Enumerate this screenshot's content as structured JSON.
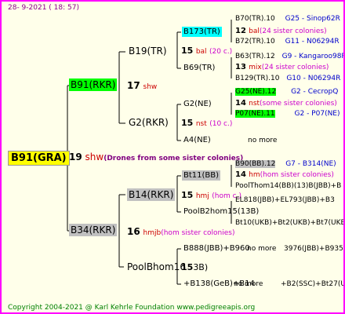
{
  "header": {
    "date": "28-  9-2021 ( 18: 57)"
  },
  "footer": {
    "copyright": "Copyright 2004-2021 @ Karl Kehrle Foundation    www.pedigreeapis.org"
  },
  "root": {
    "name": "B91(GRA)",
    "gen_num": "19",
    "gen_tag": "shw",
    "gen_note": "(Drones from some sister colonies)"
  },
  "gen1": {
    "top": {
      "name": "B91(RKR)",
      "num": "17",
      "tag": "shw"
    },
    "bottom": {
      "name": "B34(RKR)",
      "num": "16",
      "tag": "hmjb",
      "note": "(hom sister colonies)"
    }
  },
  "gen2": {
    "a": {
      "name": "B19(TR)",
      "num": "15",
      "tag": "bal",
      "note": "(20 c.)"
    },
    "b": {
      "name": "G2(RKR)",
      "num": "15",
      "tag": "nst",
      "note": "(10 c.)"
    },
    "c": {
      "name": "B14(RKR)",
      "num": "15",
      "tag": "hmj",
      "note": "(hom c.)"
    },
    "d": {
      "name": "PoolBhom16",
      "num": "15",
      "suffix": "3B)"
    }
  },
  "gen3": {
    "a1": {
      "name": "B173(TR)",
      "num": "12",
      "tag": "bal",
      "note": "(24 sister colonies)"
    },
    "a2": {
      "name": "B69(TR)",
      "num": "13",
      "tag": "mix",
      "note": "(24 sister colonies)"
    },
    "b1": {
      "name": "G2(NE)",
      "num": "14",
      "tag": "nst",
      "note": "(some sister colonies)"
    },
    "b2": {
      "name": "A4(NE)",
      "more": "no more"
    },
    "c1": {
      "name": "Bt11(BB)",
      "num": "14",
      "tag": "hm",
      "note": "(hom sister colonies)"
    },
    "c2": {
      "name": "PoolB2hom15(13B)"
    },
    "d1": {
      "name": "B888(JBB)+B960",
      "more": "no more"
    },
    "d2": {
      "name": "+B138(GeB)+B14",
      "more": "no more"
    }
  },
  "gen4": [
    {
      "name": "B70(TR).10",
      "extra": "G25 - Sinop62R"
    },
    {
      "name": "B72(TR).10",
      "extra": "G11 - N06294R"
    },
    {
      "name": "B63(TR).12",
      "extra": "G9 - Kangaroo98R"
    },
    {
      "name": "B129(TR).10",
      "extra": "G10 - N06294R"
    },
    {
      "name": "G25(NE).12",
      "extra": "G2 - CecropQ"
    },
    {
      "name": "P07(NE).11",
      "extra": "G2 - P07(NE)"
    },
    {
      "name": "B90(BB).12",
      "extra": "G7 - B314(NE)"
    },
    {
      "name": "PoolThom14(BB)(13)B(JBB)+B"
    },
    {
      "name": "EL818(JBB)+EL793(JBB)+B3"
    },
    {
      "name": "Bt10(UKB)+Bt2(UKB)+Bt7(UKB"
    },
    {
      "name": "3976(JBB)+B935(JB"
    },
    {
      "name": "+B2(SSC)+Bt27(UK"
    }
  ]
}
